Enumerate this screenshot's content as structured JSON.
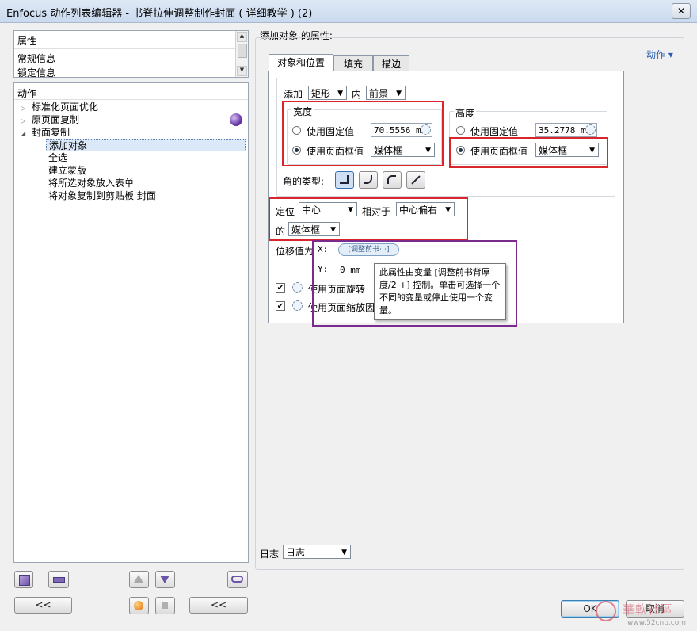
{
  "window": {
    "title": "Enfocus 动作列表编辑器 - 书脊拉伸调整制作封面 ( 详细教学 ) (2)",
    "close_glyph": "✕"
  },
  "left": {
    "properties_panel": {
      "header": "属性",
      "items": [
        "常规信息",
        "锁定信息"
      ]
    },
    "actions_panel": {
      "header": "动作",
      "tree": [
        {
          "label": "标准化页面优化",
          "expander": "▷"
        },
        {
          "label": "原页面复制",
          "expander": "▷"
        },
        {
          "label": "封面复制",
          "expander": "◢"
        }
      ],
      "children": [
        "添加对象",
        "全选",
        "建立蒙版",
        "将所选对象放入表单",
        "将对象复制到剪贴板 封面"
      ],
      "selected_child": "添加对象"
    },
    "bottom_buttons": {
      "collapse_left_label": "<<",
      "collapse_right_label": "<<"
    }
  },
  "right": {
    "heading": "添加对象 的属性:",
    "actions_link": "动作 ▾",
    "tabs": [
      "对象和位置",
      "填充",
      "描边"
    ],
    "active_tab": "对象和位置",
    "add_row": {
      "prefix": "添加",
      "object_type": "矩形",
      "in_label": "内",
      "layer": "前景"
    },
    "width_group": {
      "title": "宽度",
      "fixed_label": "使用固定值",
      "fixed_value": "70.5556 mm",
      "page_box_label": "使用页面框值",
      "page_box_value": "媒体框",
      "selected": "page_box"
    },
    "height_group": {
      "title": "高度",
      "fixed_label": "使用固定值",
      "fixed_value": "35.2778 mm",
      "page_box_label": "使用页面框值",
      "page_box_value": "媒体框",
      "selected": "page_box"
    },
    "corner_label": "角的类型:",
    "positioning": {
      "label": "定位",
      "value": "中心",
      "relative_label": "相对于",
      "relative_value": "中心偏右",
      "of_label": "的",
      "of_value": "媒体框"
    },
    "offset": {
      "label": "位移值为",
      "x_label": "X:",
      "x_variable": "[调整前书⋯]",
      "y_label": "Y:",
      "y_value": "0 mm"
    },
    "checkboxes": [
      {
        "label": "使用页面旋转",
        "checked": true
      },
      {
        "label": "使用页面缩放因",
        "checked": true
      }
    ],
    "tooltip": "此属性由变量 [调整前书背厚度/2 +] 控制。单击可选择一个不同的变量或停止使用一个变量。",
    "log": {
      "label": "日志",
      "value": "日志"
    },
    "ok_label": "OK",
    "cancel_label": "取消"
  },
  "watermark": {
    "text": "華軟社區",
    "url": "www.52cnp.com"
  },
  "colors": {
    "annotation_red": "#d9262d",
    "annotation_purple": "#7a2b8c",
    "link_blue": "#2a5db0",
    "selection_bg": "#dbe8f7"
  }
}
